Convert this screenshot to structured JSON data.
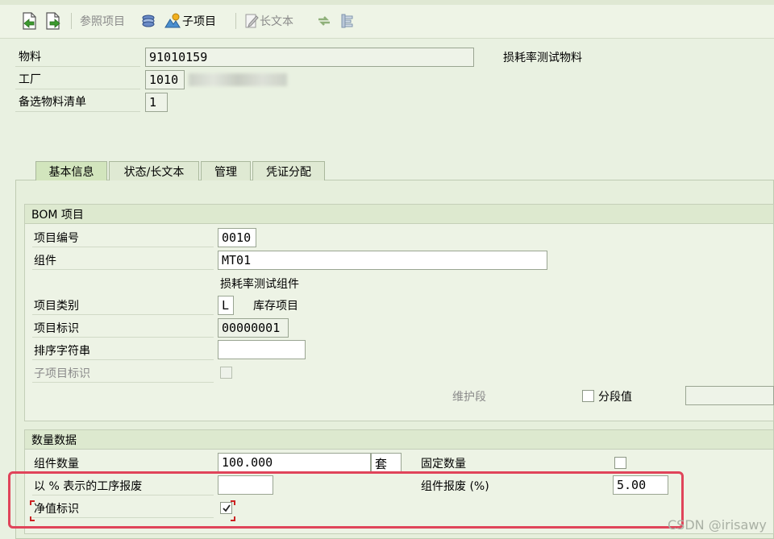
{
  "toolbar": {
    "ref_item_label": "参照项目",
    "sub_item_label": "子项目",
    "long_text_label": "长文本"
  },
  "header": {
    "material_label": "物料",
    "material_value": "91010159",
    "material_desc": "损耗率测试物料",
    "plant_label": "工厂",
    "plant_value": "1010",
    "alt_bom_label": "备选物料清单",
    "alt_bom_value": "1"
  },
  "tabs": [
    {
      "label": "基本信息",
      "active": true
    },
    {
      "label": "状态/长文本",
      "active": false
    },
    {
      "label": "管理",
      "active": false
    },
    {
      "label": "凭证分配",
      "active": false
    }
  ],
  "bom_item": {
    "title": "BOM 项目",
    "item_no_label": "项目编号",
    "item_no_value": "0010",
    "component_label": "组件",
    "component_value": "MT01",
    "component_desc": "损耗率测试组件",
    "item_cat_label": "项目类别",
    "item_cat_value": "L",
    "item_cat_desc": "库存项目",
    "item_id_label": "项目标识",
    "item_id_value": "00000001",
    "sort_string_label": "排序字符串",
    "sort_string_value": "",
    "sub_item_id_label": "子项目标识",
    "maint_section_label": "维护段",
    "segment_value_label": "分段值"
  },
  "quantity": {
    "title": "数量数据",
    "comp_qty_label": "组件数量",
    "comp_qty_value": "100.000",
    "uom_value": "套",
    "fixed_qty_label": "固定数量",
    "fixed_qty_checked": false,
    "op_scrap_label": "以 % 表示的工序报废",
    "op_scrap_value": "",
    "comp_scrap_label": "组件报废 (%)",
    "comp_scrap_value": "5.00",
    "net_id_label": "净值标识",
    "net_id_checked": true
  },
  "watermark": "CSDN @irisawy",
  "colors": {
    "highlight_box": "#e0445a",
    "background": "#e9f1e1"
  }
}
